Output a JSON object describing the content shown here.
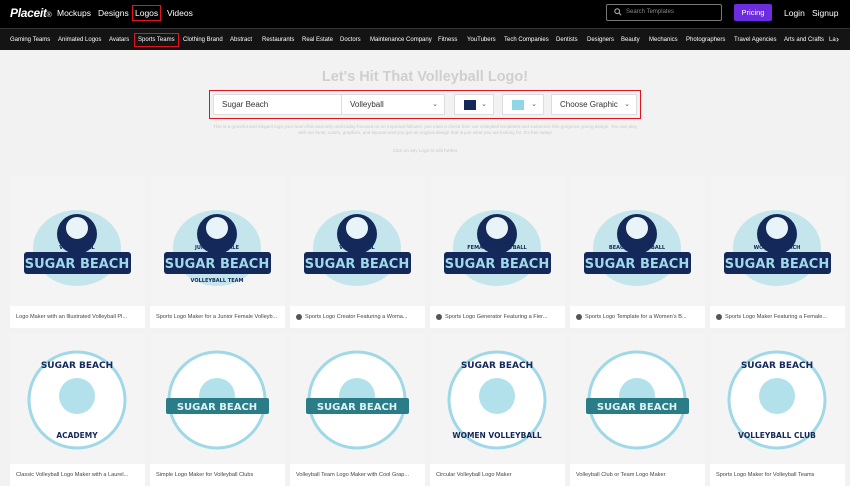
{
  "header": {
    "brand": "Placeit",
    "brand_suffix": "®",
    "nav": [
      "Mockups",
      "Designs",
      "Logos",
      "Videos"
    ],
    "search_placeholder": "Search Templates",
    "pricing": "Pricing",
    "login": "Login",
    "signup": "Signup"
  },
  "categories": [
    "Gaming Teams",
    "Animated Logos",
    "Avatars",
    "Sports Teams",
    "Clothing Brand",
    "Abstract",
    "Restaurants",
    "Real Estate",
    "Doctors",
    "Maintenance Company",
    "Fitness",
    "YouTubers",
    "Tech Companies",
    "Dentists",
    "Designers",
    "Beauty",
    "Mechanics",
    "Photographers",
    "Travel Agencies",
    "Arts and Crafts",
    "La"
  ],
  "hero": {
    "title": "Let's Hit That Volleyball Logo!",
    "name_value": "Sugar Beach",
    "industry_value": "Volleyball",
    "graphic_label": "Choose Graphic",
    "color1": "#14285a",
    "color2": "#8fd6e6",
    "description": "This is a graceful and elegant logo your team-first-and-only-until-today-focused on on imported follower, just meet a check from our volleyball templates and customize this gorgeous young design. You can play with our fonts, colors, graphics, and layouts until you get an original design that is just what you are looking for. It's free away!",
    "hint": "Click on any Logo to edit further"
  },
  "colors": {
    "accent": "#6c2ce0",
    "outline": "#e0141e",
    "teal": "#2a7c86",
    "navy": "#14285a",
    "light": "#9fd8e6"
  },
  "cards": [
    {
      "caption": "Logo Maker with an Illustrated Volleyball Pl...",
      "video": false,
      "top": "VOLLEYBALL",
      "title": "SUGAR BEACH",
      "sub": ""
    },
    {
      "caption": "Sports Logo Maker for a Junior Female Volleyb...",
      "video": false,
      "top": "JUNIOR FEMALE",
      "title": "SUGAR BEACH",
      "sub": "VOLLEYBALL TEAM"
    },
    {
      "caption": "Sports Logo Creator Featuring a Woma...",
      "video": true,
      "top": "VOLLEYBALL",
      "title": "SUGAR BEACH",
      "sub": ""
    },
    {
      "caption": "Sports Logo Generator Featuring a Fier...",
      "video": true,
      "top": "FEMALE VOLLEYBALL",
      "title": "SUGAR BEACH",
      "sub": ""
    },
    {
      "caption": "Sports Logo Template for a Women's B...",
      "video": true,
      "top": "BEACH VOLLEYBALL",
      "title": "SUGAR BEACH",
      "sub": ""
    },
    {
      "caption": "Sports Logo Maker Featuring a Female...",
      "video": true,
      "top": "WOMENS BEACH",
      "title": "SUGAR BEACH",
      "sub": ""
    },
    {
      "caption": "Classic Volleyball Logo Maker with a Laurel...",
      "video": false,
      "top": "SUGAR BEACH",
      "title": "",
      "sub": "ACADEMY"
    },
    {
      "caption": "Simple Logo Maker for Volleyball Clubs",
      "video": false,
      "top": "",
      "title": "SUGAR BEACH",
      "sub": ""
    },
    {
      "caption": "Volleyball Team Logo Maker with Cool Grap...",
      "video": false,
      "top": "",
      "title": "SUGAR BEACH",
      "sub": ""
    },
    {
      "caption": "Circular Volleyball Logo Maker",
      "video": false,
      "top": "SUGAR BEACH",
      "title": "",
      "sub": "WOMEN VOLLEYBALL"
    },
    {
      "caption": "Volleyball Club or Team Logo Maker",
      "video": false,
      "top": "",
      "title": "SUGAR BEACH",
      "sub": ""
    },
    {
      "caption": "Sports Logo Maker for Volleyball Teams",
      "video": false,
      "top": "SUGAR BEACH",
      "title": "",
      "sub": "VOLLEYBALL CLUB"
    }
  ]
}
